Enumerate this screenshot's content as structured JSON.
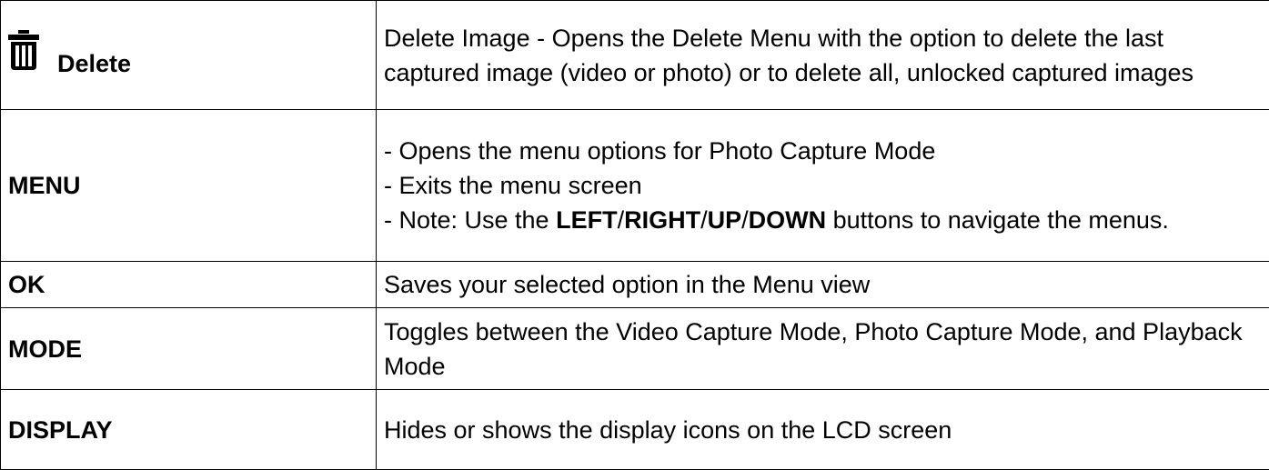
{
  "rows": [
    {
      "key": "Delete",
      "icon": "trash-icon",
      "desc": "Delete Image - Opens the Delete Menu with the option to delete the last captured image (video or photo) or to delete all, unlocked captured images"
    },
    {
      "key": "MENU",
      "desc_lines": [
        "- Opens the menu options for Photo Capture Mode",
        "- Exits the menu screen"
      ],
      "note": {
        "prefix": "- Note: Use the ",
        "left": "LEFT",
        "sep1": "/",
        "right": "RIGHT",
        "sep2": "/",
        "up": "UP",
        "sep3": "/",
        "down": "DOWN",
        "suffix": " buttons to navigate the menus."
      }
    },
    {
      "key": "OK",
      "desc": "Saves your selected option in the Menu view"
    },
    {
      "key": "MODE",
      "desc": "Toggles between the Video Capture Mode, Photo Capture Mode, and Playback Mode"
    },
    {
      "key": "DISPLAY",
      "desc": "Hides or shows the display icons on the LCD screen"
    }
  ]
}
